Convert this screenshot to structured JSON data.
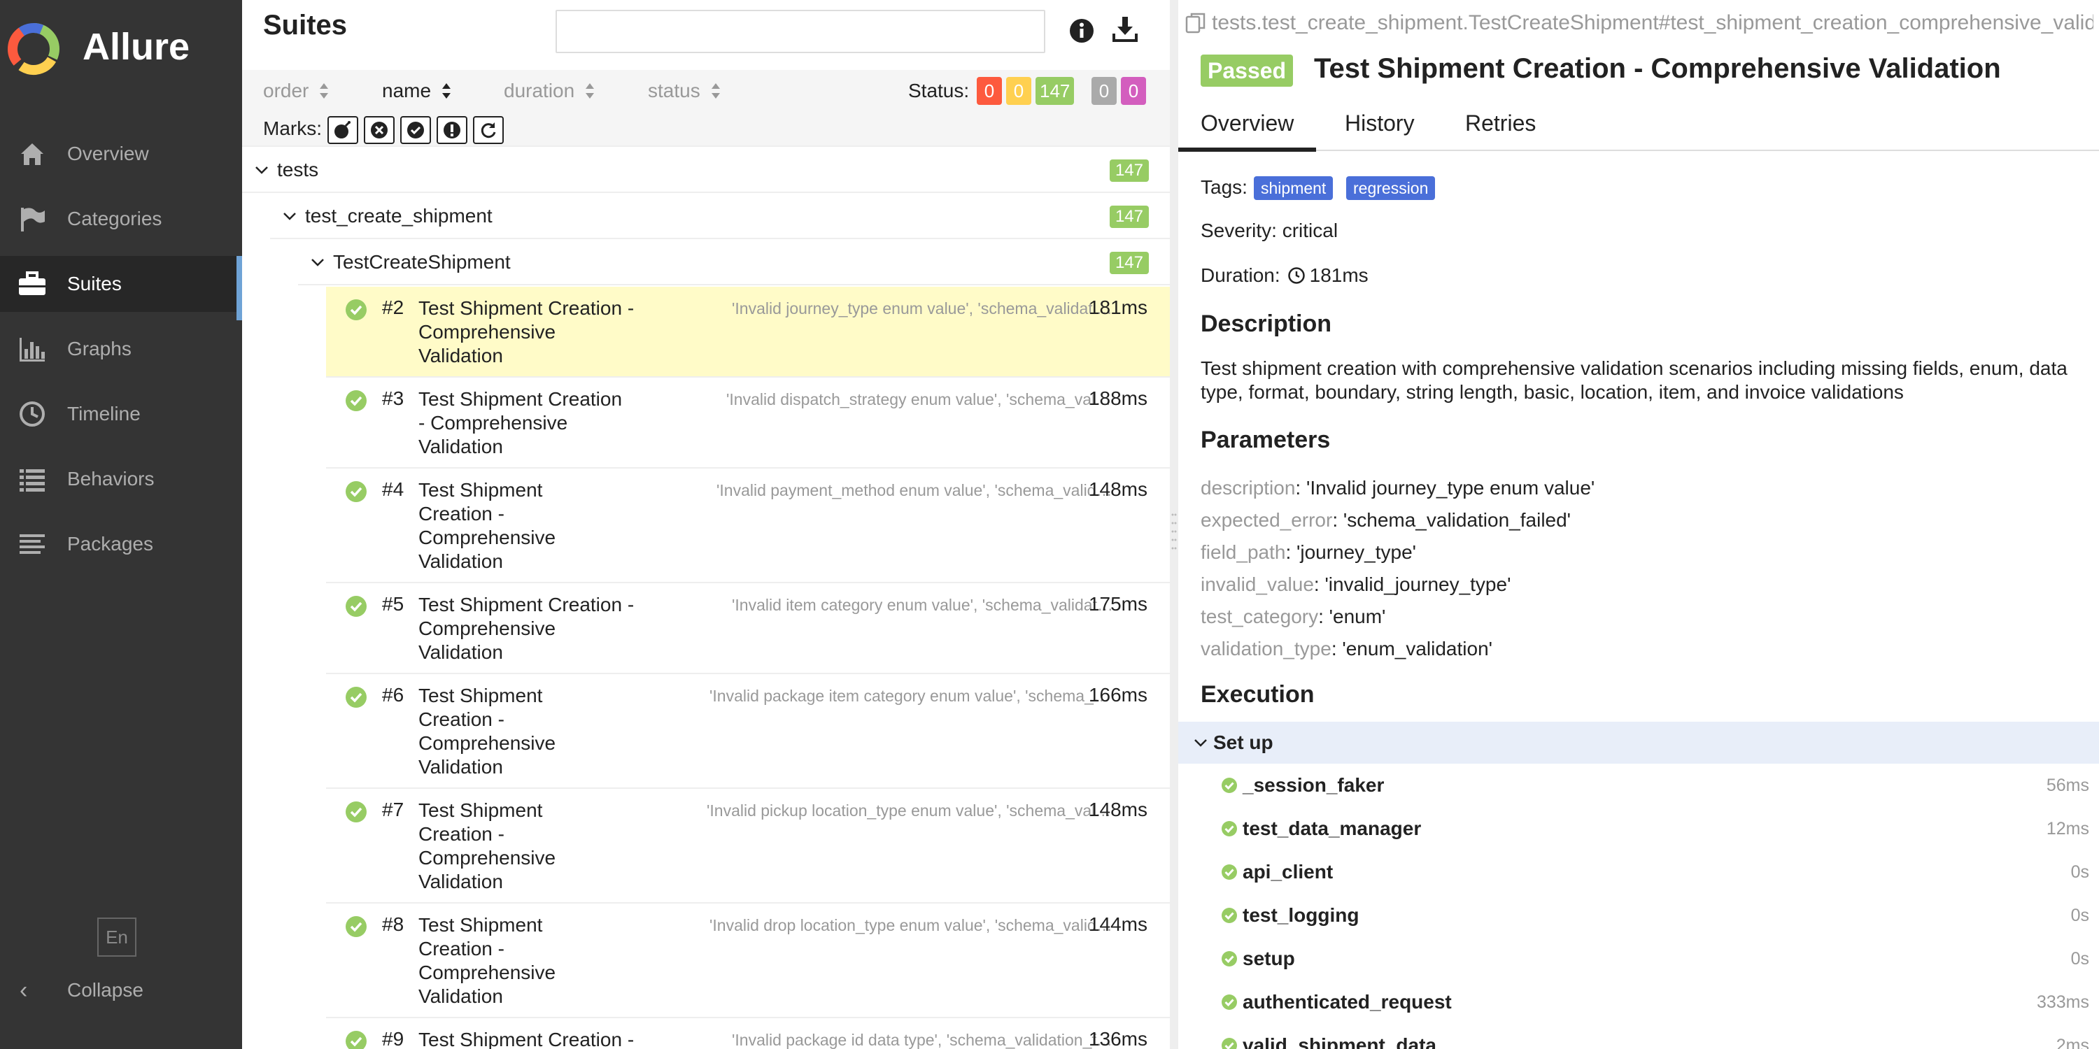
{
  "app": {
    "name": "Allure"
  },
  "nav": {
    "items": [
      {
        "label": "Overview",
        "icon": "home-icon"
      },
      {
        "label": "Categories",
        "icon": "flag-icon"
      },
      {
        "label": "Suites",
        "icon": "briefcase-icon"
      },
      {
        "label": "Graphs",
        "icon": "bar-chart-icon"
      },
      {
        "label": "Timeline",
        "icon": "clock-icon"
      },
      {
        "label": "Behaviors",
        "icon": "list-icon"
      },
      {
        "label": "Packages",
        "icon": "lines-icon"
      }
    ],
    "active": "Suites",
    "lang": "En",
    "collapse": "Collapse"
  },
  "suites": {
    "title": "Suites",
    "search_value": "",
    "sort": {
      "order": "order",
      "name": "name",
      "duration": "duration",
      "status": "status",
      "active": "name"
    },
    "status_label": "Status:",
    "status_counts": [
      {
        "value": "0",
        "color": "#fd5a3e",
        "meaning": "failed"
      },
      {
        "value": "0",
        "color": "#ffd050",
        "meaning": "broken"
      },
      {
        "value": "147",
        "color": "#97cc64",
        "meaning": "passed"
      },
      {
        "value": "0",
        "color": "#aaaaaa",
        "meaning": "skipped"
      },
      {
        "value": "0",
        "color": "#d35ebe",
        "meaning": "unknown"
      }
    ],
    "marks_label": "Marks:",
    "tree": [
      {
        "label": "tests",
        "count": "147"
      },
      {
        "label": "test_create_shipment",
        "count": "147"
      },
      {
        "label": "TestCreateShipment",
        "count": "147"
      }
    ],
    "cases": [
      {
        "num": "#2",
        "name_lines": [
          "Test Shipment Creation -",
          "Comprehensive",
          "Validation"
        ],
        "params": "'Invalid journey_type enum value', 'schema_validation_failed'",
        "duration": "181ms",
        "selected": true
      },
      {
        "num": "#3",
        "name_lines": [
          "Test Shipment Creation",
          "- Comprehensive",
          "Validation"
        ],
        "params": "'Invalid dispatch_strategy enum value', 'schema_validation_failed'",
        "duration": "188ms",
        "selected": false
      },
      {
        "num": "#4",
        "name_lines": [
          "Test Shipment",
          "Creation -",
          "Comprehensive",
          "Validation"
        ],
        "params": "'Invalid payment_method enum value', 'schema_validation_failed'",
        "duration": "148ms",
        "selected": false
      },
      {
        "num": "#5",
        "name_lines": [
          "Test Shipment Creation -",
          "Comprehensive",
          "Validation"
        ],
        "params": "'Invalid item category enum value', 'schema_validation_failed'",
        "duration": "175ms",
        "selected": false
      },
      {
        "num": "#6",
        "name_lines": [
          "Test Shipment",
          "Creation -",
          "Comprehensive",
          "Validation"
        ],
        "params": "'Invalid package item category enum value', 'schema_validation_failed'",
        "duration": "166ms",
        "selected": false
      },
      {
        "num": "#7",
        "name_lines": [
          "Test Shipment",
          "Creation -",
          "Comprehensive",
          "Validation"
        ],
        "params": "'Invalid pickup location_type enum value', 'schema_validation_failed'",
        "duration": "148ms",
        "selected": false
      },
      {
        "num": "#8",
        "name_lines": [
          "Test Shipment",
          "Creation -",
          "Comprehensive",
          "Validation"
        ],
        "params": "'Invalid drop location_type enum value', 'schema_validation_failed'",
        "duration": "144ms",
        "selected": false
      },
      {
        "num": "#9",
        "name_lines": [
          "Test Shipment Creation -"
        ],
        "params": "'Invalid package id data type', 'schema_validation_failed',",
        "duration": "136ms",
        "selected": false
      }
    ]
  },
  "detail": {
    "breadcrumb": "tests.test_create_shipment.TestCreateShipment#test_shipment_creation_comprehensive_validation",
    "status": "Passed",
    "title": "Test Shipment Creation - Comprehensive Validation",
    "tabs": [
      "Overview",
      "History",
      "Retries"
    ],
    "active_tab": "Overview",
    "tags_label": "Tags:",
    "tags": [
      "shipment",
      "regression"
    ],
    "severity_label": "Severity:",
    "severity": "critical",
    "duration_label": "Duration:",
    "duration": "181ms",
    "description_heading": "Description",
    "description": "Test shipment creation with comprehensive validation scenarios including missing fields, enum, data type, format, boundary, string length, basic, location, item, and invoice validations",
    "parameters_heading": "Parameters",
    "parameters": [
      {
        "key": "description",
        "value": "'Invalid journey_type enum value'"
      },
      {
        "key": "expected_error",
        "value": "'schema_validation_failed'"
      },
      {
        "key": "field_path",
        "value": "'journey_type'"
      },
      {
        "key": "invalid_value",
        "value": "'invalid_journey_type'"
      },
      {
        "key": "test_category",
        "value": "'enum'"
      },
      {
        "key": "validation_type",
        "value": "'enum_validation'"
      }
    ],
    "execution_heading": "Execution",
    "setup_label": "Set up",
    "fixtures": [
      {
        "name": "_session_faker",
        "duration": "56ms"
      },
      {
        "name": "test_data_manager",
        "duration": "12ms"
      },
      {
        "name": "api_client",
        "duration": "0s"
      },
      {
        "name": "test_logging",
        "duration": "0s"
      },
      {
        "name": "setup",
        "duration": "0s"
      },
      {
        "name": "authenticated_request",
        "duration": "333ms"
      },
      {
        "name": "valid_shipment_data",
        "duration": "2ms"
      }
    ]
  },
  "colors": {
    "sidebar_bg": "#343434",
    "passed": "#97cc64",
    "selected_row": "#fffbc8",
    "tag_bg": "#4a6fd9",
    "setup_bar": "#e8eef9"
  }
}
